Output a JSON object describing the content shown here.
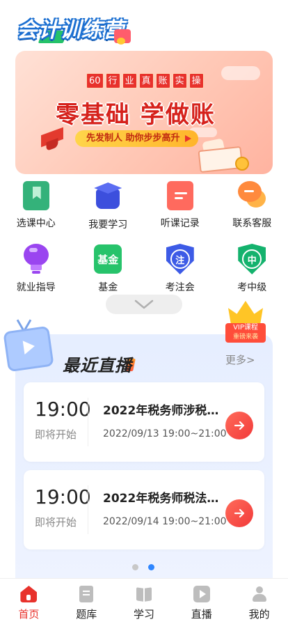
{
  "header": {
    "logo_text": "会计训练营"
  },
  "banner": {
    "tag": [
      "60",
      "行",
      "业",
      "真",
      "账",
      "实",
      "操"
    ],
    "title": "零基础 学做账",
    "subtitle": "先发制人 助你步步高升"
  },
  "menu": {
    "items": [
      {
        "label": "选课中心",
        "icon": "bookmark-book-icon"
      },
      {
        "label": "我要学习",
        "icon": "graduation-cap-icon"
      },
      {
        "label": "听课记录",
        "icon": "notes-icon"
      },
      {
        "label": "联系客服",
        "icon": "chat-bubbles-icon"
      },
      {
        "label": "就业指导",
        "icon": "lightbulb-icon"
      },
      {
        "label": "基金",
        "icon": "fund-icon",
        "icon_text": "基金"
      },
      {
        "label": "考注会",
        "icon": "cpa-shield-icon",
        "icon_text": "注"
      },
      {
        "label": "考中级",
        "icon": "intermediate-shield-icon",
        "icon_text": "中"
      }
    ]
  },
  "live": {
    "title": "最近直播",
    "more": "更多>",
    "vip_line1": "VIP课程",
    "vip_line2": "重磅来袭",
    "cards": [
      {
        "time": "19:00",
        "state": "即将开始",
        "title": "2022年税务师涉税…",
        "date": "2022/09/13 19:00~21:00"
      },
      {
        "time": "19:00",
        "state": "即将开始",
        "title": "2022年税务师税法…",
        "date": "2022/09/14 19:00~21:00"
      }
    ],
    "page_index": 2,
    "page_count": 2
  },
  "tabbar": {
    "tabs": [
      {
        "label": "首页",
        "icon": "home-icon",
        "active": true
      },
      {
        "label": "题库",
        "icon": "question-bank-icon",
        "active": false
      },
      {
        "label": "学习",
        "icon": "open-book-icon",
        "active": false
      },
      {
        "label": "直播",
        "icon": "live-play-icon",
        "active": false
      },
      {
        "label": "我的",
        "icon": "profile-icon",
        "active": false
      }
    ]
  },
  "colors": {
    "accent_red": "#e8322c",
    "live_bg": "#e6eeff",
    "dot_active": "#2f86ff"
  }
}
